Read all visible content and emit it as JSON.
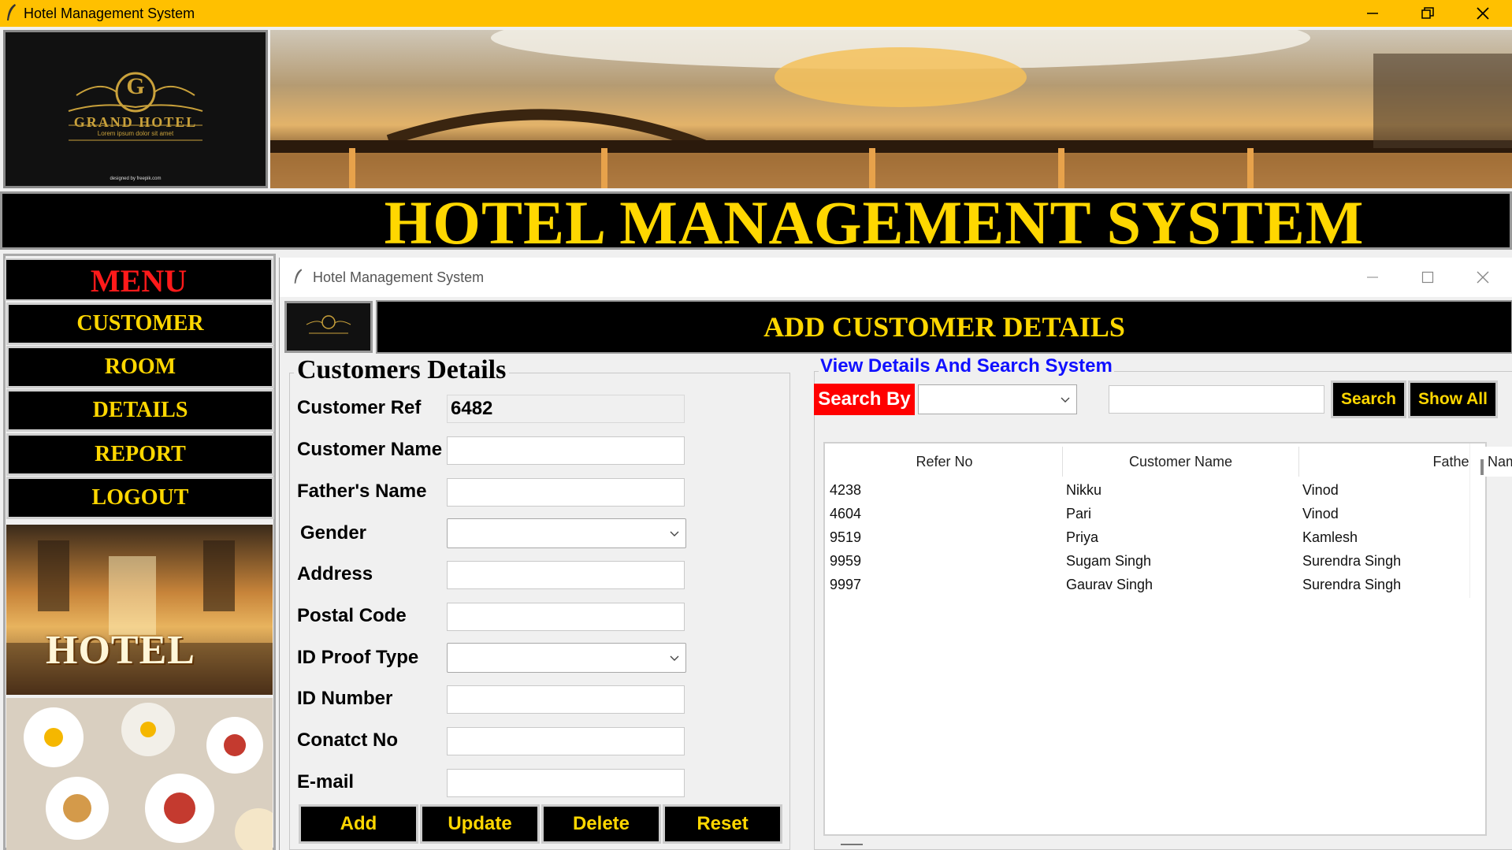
{
  "window": {
    "title": "Hotel Management System"
  },
  "header": {
    "logo_initial": "G",
    "logo_name": "GRAND HOTEL",
    "logo_tagline": "Lorem ipsum dolor sit amet",
    "logo_credit": "designed by freepik.com",
    "main_title": "HOTEL MANAGEMENT SYSTEM"
  },
  "menu": {
    "title": "MENU",
    "items": [
      {
        "label": "CUSTOMER"
      },
      {
        "label": "ROOM"
      },
      {
        "label": "DETAILS"
      },
      {
        "label": "REPORT"
      },
      {
        "label": "LOGOUT"
      }
    ],
    "side_image_text": "HOTEL"
  },
  "inner_window": {
    "title": "Hotel Management System",
    "heading": "ADD CUSTOMER DETAILS"
  },
  "customer_form": {
    "legend": "Customers Details",
    "fields": {
      "customer_ref": {
        "label": "Customer Ref",
        "value": "6482"
      },
      "customer_name": {
        "label": "Customer Name",
        "value": ""
      },
      "fathers_name": {
        "label": "Father's Name",
        "value": ""
      },
      "gender": {
        "label": "Gender",
        "value": ""
      },
      "address": {
        "label": "Address",
        "value": ""
      },
      "postal_code": {
        "label": "Postal Code",
        "value": ""
      },
      "id_proof_type": {
        "label": "ID Proof Type",
        "value": ""
      },
      "id_number": {
        "label": "ID Number",
        "value": ""
      },
      "contact_no": {
        "label": "Conatct No",
        "value": ""
      },
      "email": {
        "label": "E-mail",
        "value": ""
      }
    },
    "buttons": {
      "add": "Add",
      "update": "Update",
      "delete": "Delete",
      "reset": "Reset"
    }
  },
  "view": {
    "legend": "View Details And Search System",
    "search_by_label": "Search By",
    "search_by_value": "",
    "search_text": "",
    "search_button": "Search",
    "show_all_button": "Show All",
    "table": {
      "columns": [
        "Refer No",
        "Customer Name",
        "Father's Name"
      ],
      "rows": [
        [
          "4238",
          "Nikku",
          "Vinod"
        ],
        [
          "4604",
          "Pari",
          "Vinod"
        ],
        [
          "9519",
          "Priya",
          "Kamlesh"
        ],
        [
          "9959",
          "Sugam Singh",
          "Surendra Singh"
        ],
        [
          "9997",
          "Gaurav Singh",
          "Surendra Singh"
        ]
      ]
    }
  },
  "colors": {
    "titlebar": "#ffc000",
    "gold_text": "#ffd700",
    "menu_title": "#ff1a1a",
    "legend_blue": "#1010ff",
    "search_by_bg": "#ff0000"
  }
}
